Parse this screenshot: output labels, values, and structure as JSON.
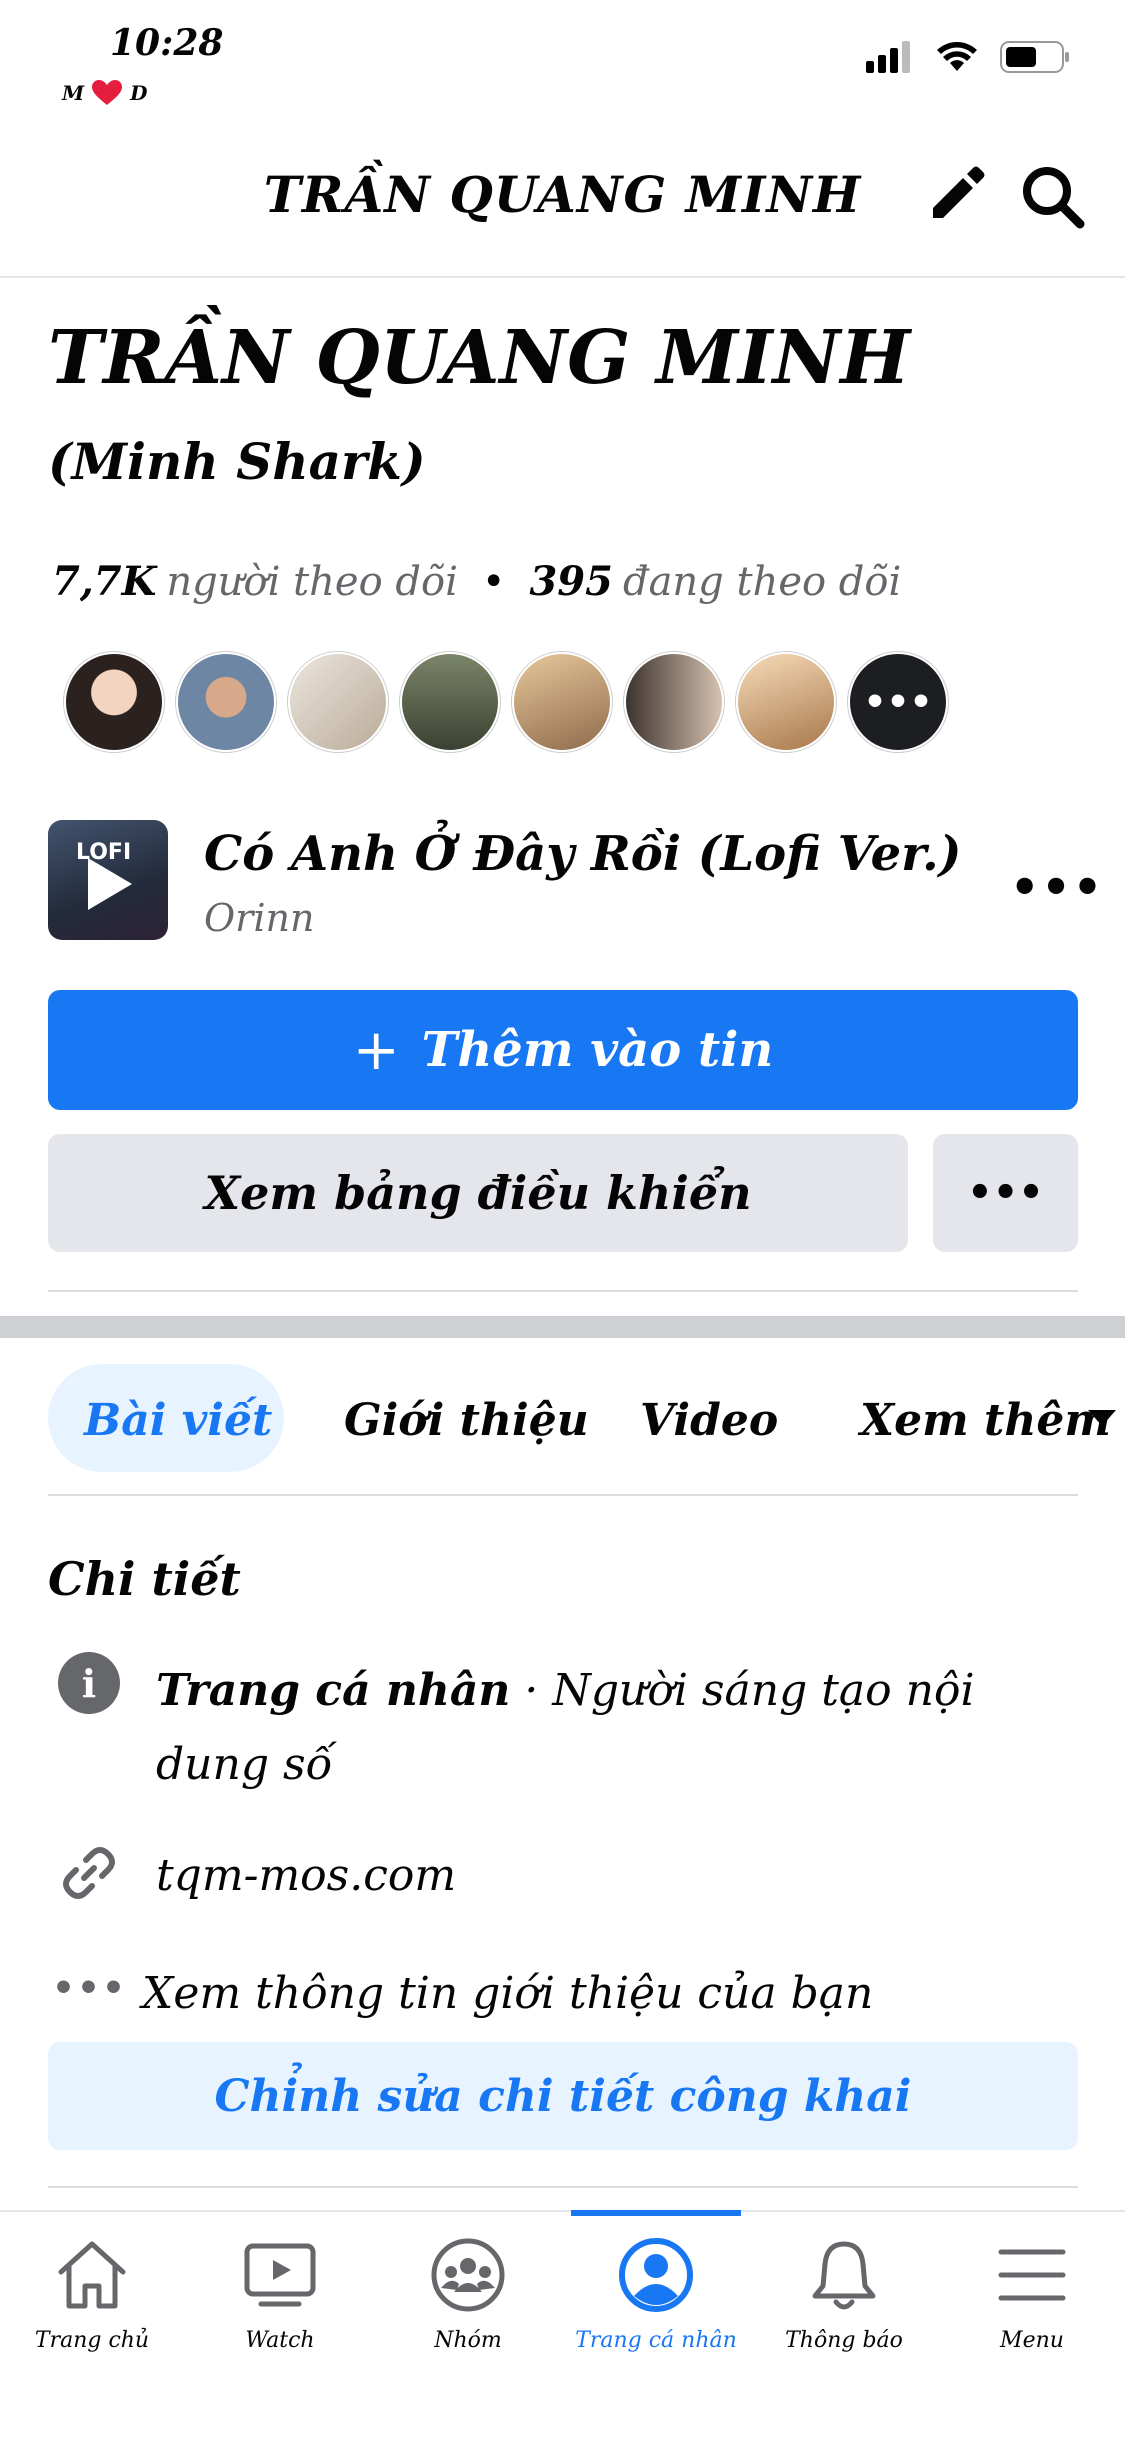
{
  "status_bar": {
    "time": "10:28",
    "left": "M",
    "right": "D"
  },
  "header": {
    "title": "TRẦN QUANG MINH",
    "edit_icon": "pencil-icon",
    "search_icon": "search-icon"
  },
  "profile": {
    "name": "TRẦN QUANG MINH",
    "nickname": "(Minh Shark)",
    "followers_count": "7,7K",
    "followers_label": "người theo dõi",
    "following_count": "395",
    "following_label": "đang theo dõi",
    "friends": [
      {
        "color": "#d9b9a3"
      },
      {
        "color": "#6d86a4"
      },
      {
        "color": "#d7cfc4"
      },
      {
        "color": "#566047"
      },
      {
        "color": "#c8a26f"
      },
      {
        "color": "#8b7668"
      },
      {
        "color": "#e8c8a0"
      }
    ],
    "more_friends": "•••"
  },
  "music": {
    "art_label": "LOFI",
    "title": "Có Anh Ở Đây Rồi (Lofi Ver.)",
    "artist": "Orinn",
    "more": "•••"
  },
  "actions": {
    "add_story": "Thêm vào tin",
    "add_icon": "+",
    "dashboard": "Xem bảng điều khiển",
    "more": "•••"
  },
  "tabs": [
    {
      "label": "Bài viết",
      "active": true
    },
    {
      "label": "Giới thiệu",
      "active": false
    },
    {
      "label": "Video",
      "active": false
    },
    {
      "label": "Xem thêm",
      "active": false
    }
  ],
  "details": {
    "title": "Chi tiết",
    "profile_type_bold": "Trang cá nhân",
    "profile_type_rest": " · Người sáng tạo nội dung số",
    "link": "tqm-mos.com",
    "about": "Xem thông tin giới thiệu của bạn",
    "edit_button": "Chỉnh sửa chi tiết công khai"
  },
  "bottom_nav": [
    {
      "label": "Trang chủ",
      "icon": "home-icon",
      "active": false
    },
    {
      "label": "Watch",
      "icon": "watch-icon",
      "active": false
    },
    {
      "label": "Nhóm",
      "icon": "groups-icon",
      "active": false
    },
    {
      "label": "Trang cá nhân",
      "icon": "profile-icon",
      "active": true
    },
    {
      "label": "Thông báo",
      "icon": "bell-icon",
      "active": false
    },
    {
      "label": "Menu",
      "icon": "menu-icon",
      "active": false
    }
  ],
  "colors": {
    "accent": "#1877f2",
    "light_accent": "#e7f3ff",
    "button_gray": "#e4e6eb",
    "muted_text": "#65676b"
  }
}
